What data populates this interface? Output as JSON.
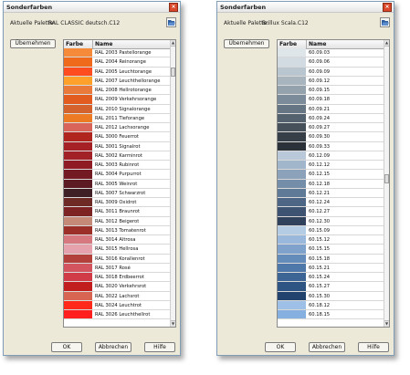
{
  "dialogs": [
    {
      "title": "Sonderfarben",
      "palette_label": "Aktuelle Palette:",
      "palette_value": "RAL CLASSIC deutsch.C12",
      "apply_label": "Übernehmen",
      "col_color": "Farbe",
      "col_name": "Name",
      "ok_label": "OK",
      "cancel_label": "Abbrechen",
      "help_label": "Hilfe",
      "scroll_position": 0.08,
      "selected_index": 29,
      "rows": [
        {
          "name": "RAL 2003 Pastellorange",
          "color": "#f58a3a"
        },
        {
          "name": "RAL 2004 Reinorange",
          "color": "#f06a1c"
        },
        {
          "name": "RAL 2005 Leuchtorange",
          "color": "#ff4d1f"
        },
        {
          "name": "RAL 2007 Leuchthellorange",
          "color": "#fda12b"
        },
        {
          "name": "RAL 2008 Hellrotorange",
          "color": "#ea7a3a"
        },
        {
          "name": "RAL 2009 Verkehrsorange",
          "color": "#e25b1f"
        },
        {
          "name": "RAL 2010 Signalorange",
          "color": "#d4622c"
        },
        {
          "name": "RAL 2011 Tieforange",
          "color": "#ec7b23"
        },
        {
          "name": "RAL 2012 Lachsorange",
          "color": "#d8645a"
        },
        {
          "name": "RAL 3000 Feuerrot",
          "color": "#b0261f"
        },
        {
          "name": "RAL 3001 Signalrot",
          "color": "#a52125"
        },
        {
          "name": "RAL 3002 Karminrot",
          "color": "#a22126"
        },
        {
          "name": "RAL 3003 Rubinrot",
          "color": "#8f1b24"
        },
        {
          "name": "RAL 3004 Purpurrot",
          "color": "#741a23"
        },
        {
          "name": "RAL 3005 Weinrot",
          "color": "#5c1a22"
        },
        {
          "name": "RAL 3007 Schwarzrot",
          "color": "#3f2125"
        },
        {
          "name": "RAL 3009 Oxidrot",
          "color": "#6e2a25"
        },
        {
          "name": "RAL 3011 Braunrot",
          "color": "#7d2323"
        },
        {
          "name": "RAL 3012 Beigerot",
          "color": "#c48a77"
        },
        {
          "name": "RAL 3013 Tomatenrot",
          "color": "#9c2f27"
        },
        {
          "name": "RAL 3014 Altrosa",
          "color": "#d7777e"
        },
        {
          "name": "RAL 3015 Hellrosa",
          "color": "#e5a2ad"
        },
        {
          "name": "RAL 3016 Korallenrot",
          "color": "#b3403a"
        },
        {
          "name": "RAL 3017 Rosé",
          "color": "#d3545f"
        },
        {
          "name": "RAL 3018 Erdbeerrot",
          "color": "#d13b47"
        },
        {
          "name": "RAL 3020 Verkehrsrot",
          "color": "#c21e1e"
        },
        {
          "name": "RAL 3022 Lachsrot",
          "color": "#d76552"
        },
        {
          "name": "RAL 3024 Leuchtrot",
          "color": "#ff2a1a"
        },
        {
          "name": "RAL 3026 Leuchthellrot",
          "color": "#ff1f1f"
        }
      ]
    },
    {
      "title": "Sonderfarben",
      "palette_label": "Aktuelle Palette:",
      "palette_value": "Brillux Scala.C12",
      "apply_label": "Übernehmen",
      "col_color": "Farbe",
      "col_name": "Name",
      "ok_label": "OK",
      "cancel_label": "Abbrechen",
      "help_label": "Hilfe",
      "scroll_position": 0.48,
      "selected_index": -1,
      "rows": [
        {
          "name": "60.09.03",
          "color": "#dfe6ea"
        },
        {
          "name": "60.09.06",
          "color": "#d2dbe1"
        },
        {
          "name": "60.09.09",
          "color": "#bac6cf"
        },
        {
          "name": "60.09.12",
          "color": "#a8b5bf"
        },
        {
          "name": "60.09.15",
          "color": "#94a2ae"
        },
        {
          "name": "60.09.18",
          "color": "#7c8b99"
        },
        {
          "name": "60.09.21",
          "color": "#667584"
        },
        {
          "name": "60.09.24",
          "color": "#54626f"
        },
        {
          "name": "60.09.27",
          "color": "#45505b"
        },
        {
          "name": "60.09.30",
          "color": "#363f48"
        },
        {
          "name": "60.09.33",
          "color": "#2a3138"
        },
        {
          "name": "60.12.09",
          "color": "#b9c9da"
        },
        {
          "name": "60.12.12",
          "color": "#a2b6cb"
        },
        {
          "name": "60.12.15",
          "color": "#8ba2ba"
        },
        {
          "name": "60.12.18",
          "color": "#748ea9"
        },
        {
          "name": "60.12.21",
          "color": "#5f7a97"
        },
        {
          "name": "60.12.24",
          "color": "#4d6685"
        },
        {
          "name": "60.12.27",
          "color": "#3d5371"
        },
        {
          "name": "60.12.30",
          "color": "#2f415b"
        },
        {
          "name": "60.15.09",
          "color": "#b5cce5"
        },
        {
          "name": "60.15.12",
          "color": "#9ab8dc"
        },
        {
          "name": "60.15.15",
          "color": "#7ea2cc"
        },
        {
          "name": "60.15.18",
          "color": "#648cbb"
        },
        {
          "name": "60.15.21",
          "color": "#4e78a9"
        },
        {
          "name": "60.15.24",
          "color": "#3c6596"
        },
        {
          "name": "60.15.27",
          "color": "#2d5482"
        },
        {
          "name": "60.15.30",
          "color": "#21436d"
        },
        {
          "name": "60.18.12",
          "color": "#9ec0e6"
        },
        {
          "name": "60.18.15",
          "color": "#86b0e0"
        }
      ]
    }
  ]
}
